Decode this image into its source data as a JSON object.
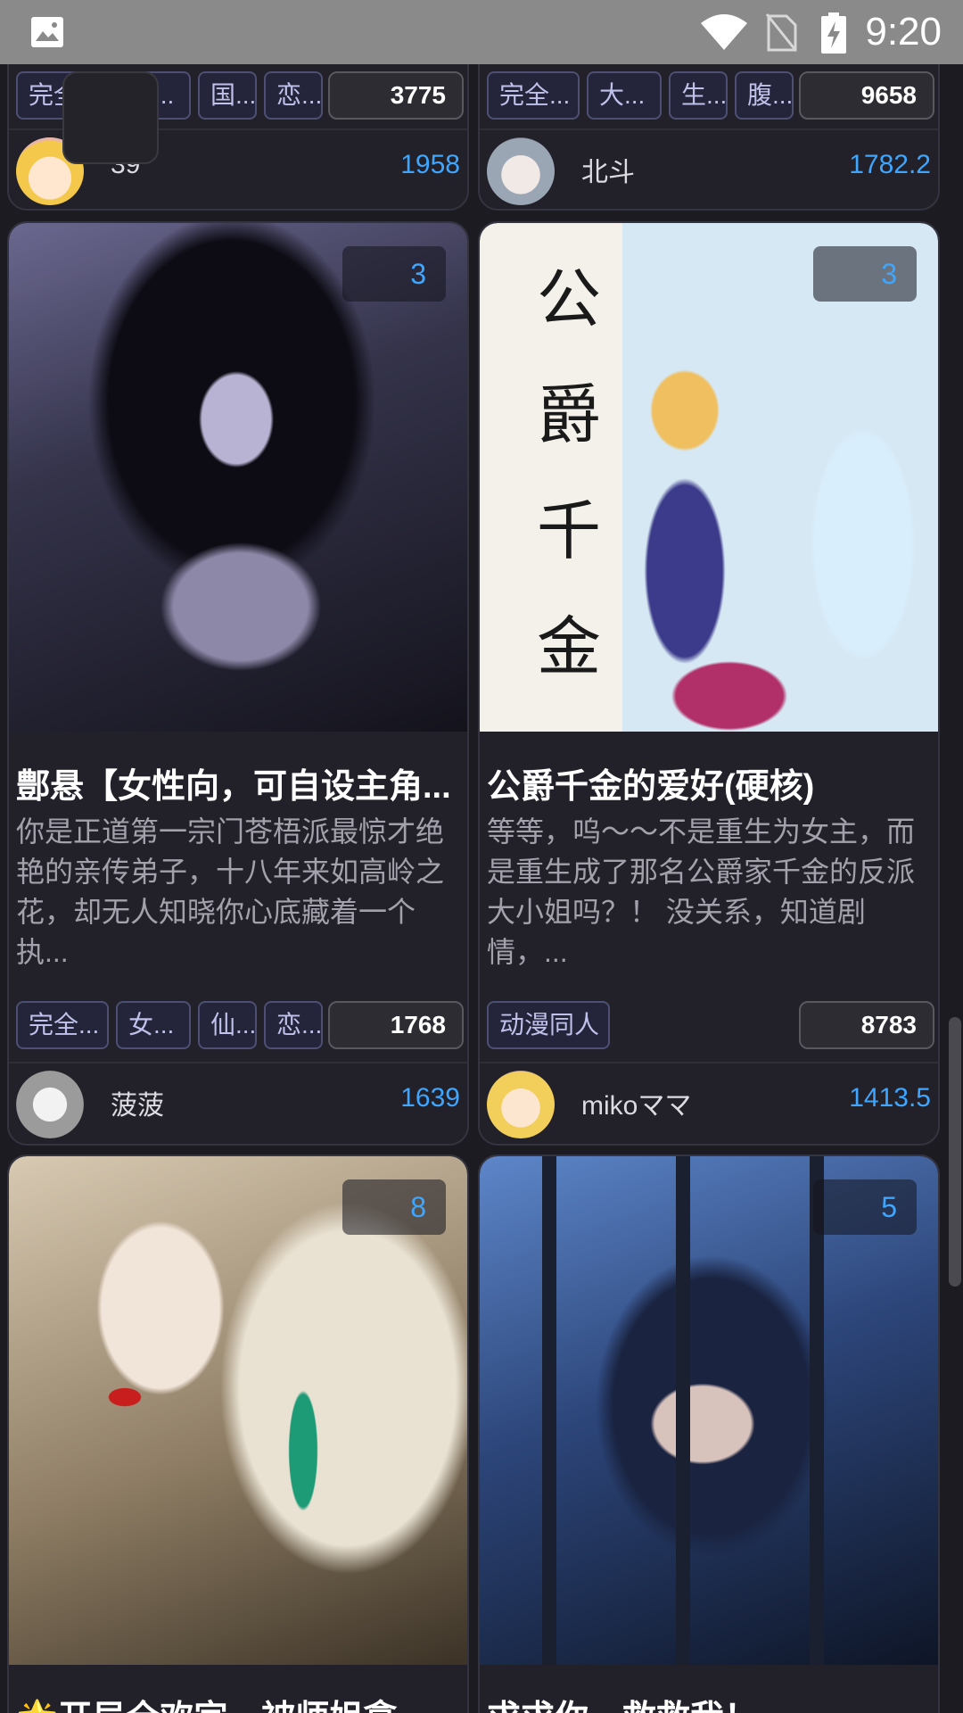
{
  "status_bar": {
    "time": "9:20"
  },
  "colors": {
    "accent": "#3ea6ff",
    "card_bg": "#222129",
    "page_bg": "#1c1b21"
  },
  "cards": [
    {
      "tags": [
        "完全...",
        "大...",
        "国...",
        "恋..."
      ],
      "popularity": "3775",
      "author": {
        "name": "39",
        "score": "1958"
      }
    },
    {
      "tags": [
        "完全...",
        "大...",
        "生...",
        "腹..."
      ],
      "popularity": "9658",
      "author": {
        "name": "北斗",
        "score": "1782.2"
      }
    },
    {
      "count": "3",
      "title": "鄷悬【女性向，可自设主角...",
      "desc": "你是正道第一宗门苍梧派最惊才绝艳的亲传弟子，十八年来如高岭之花，却无人知晓你心底藏着一个执...",
      "tags": [
        "完全...",
        "女...",
        "仙...",
        "恋..."
      ],
      "popularity": "1768",
      "author": {
        "name": "菠菠",
        "score": "1639"
      }
    },
    {
      "count": "3",
      "cover_text": [
        "公",
        "爵",
        "千",
        "金"
      ],
      "title": "公爵千金的爱好(硬核)",
      "desc": "等等，呜～～不是重生为女主，而是重生成了那名公爵家千金的反派大小姐吗？！ 没关系，知道剧情，...",
      "tags": [
        "动漫同人"
      ],
      "popularity": "8783",
      "author": {
        "name": "mikoママ",
        "score": "1413.5"
      }
    },
    {
      "count": "8",
      "title": "🌟开局全欢宗，被师姐拿..."
    },
    {
      "count": "5",
      "title": "求求你，救救我！"
    }
  ]
}
